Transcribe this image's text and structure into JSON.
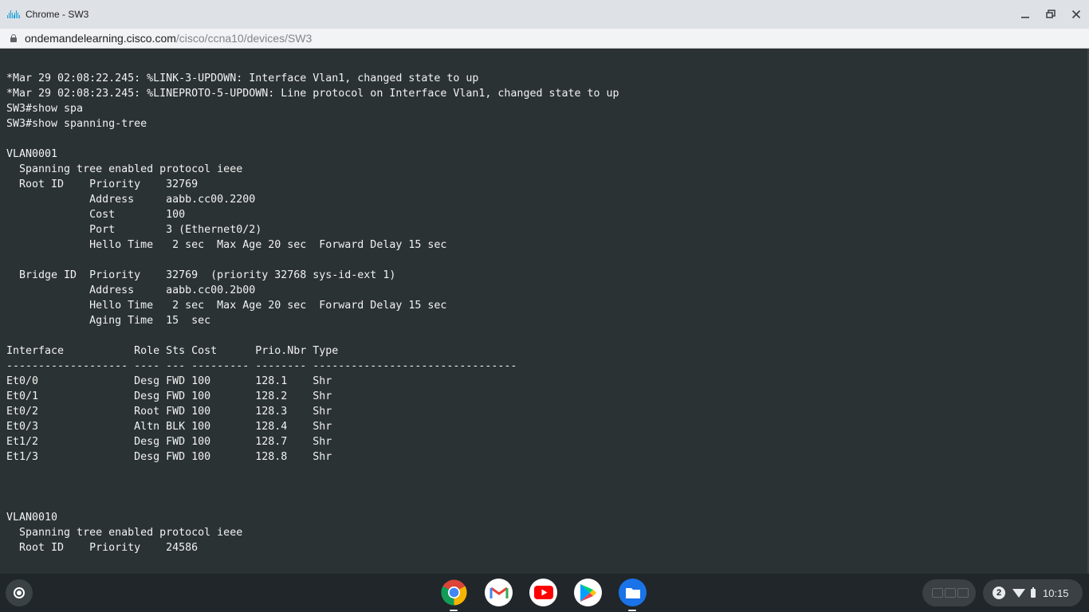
{
  "window": {
    "title": "Chrome - SW3",
    "minimize_icon": "minimize-icon",
    "restore_icon": "restore-icon",
    "close_icon": "close-icon"
  },
  "address_bar": {
    "host": "ondemandelearning.cisco.com",
    "path": "/cisco/ccna10/devices/SW3"
  },
  "terminal": {
    "lines": [
      "*Mar 29 02:08:22.245: %LINK-3-UPDOWN: Interface Vlan1, changed state to up",
      "*Mar 29 02:08:23.245: %LINEPROTO-5-UPDOWN: Line protocol on Interface Vlan1, changed state to up",
      "SW3#show spa",
      "SW3#show spanning-tree",
      "",
      "VLAN0001",
      "  Spanning tree enabled protocol ieee",
      "  Root ID    Priority    32769",
      "             Address     aabb.cc00.2200",
      "             Cost        100",
      "             Port        3 (Ethernet0/2)",
      "             Hello Time   2 sec  Max Age 20 sec  Forward Delay 15 sec",
      "",
      "  Bridge ID  Priority    32769  (priority 32768 sys-id-ext 1)",
      "             Address     aabb.cc00.2b00",
      "             Hello Time   2 sec  Max Age 20 sec  Forward Delay 15 sec",
      "             Aging Time  15  sec",
      "",
      "Interface           Role Sts Cost      Prio.Nbr Type",
      "------------------- ---- --- --------- -------- --------------------------------",
      "Et0/0               Desg FWD 100       128.1    Shr",
      "Et0/1               Desg FWD 100       128.2    Shr",
      "Et0/2               Root FWD 100       128.3    Shr",
      "Et0/3               Altn BLK 100       128.4    Shr",
      "Et1/2               Desg FWD 100       128.7    Shr",
      "Et1/3               Desg FWD 100       128.8    Shr",
      "",
      "",
      "",
      "VLAN0010",
      "  Spanning tree enabled protocol ieee",
      "  Root ID    Priority    24586"
    ]
  },
  "shelf": {
    "launcher_icon": "launcher-icon",
    "apps": [
      {
        "name": "chrome-icon",
        "active": true
      },
      {
        "name": "gmail-icon",
        "active": false
      },
      {
        "name": "youtube-icon",
        "active": false
      },
      {
        "name": "play-store-icon",
        "active": false
      },
      {
        "name": "files-icon",
        "active": true
      }
    ],
    "notification_count": "2",
    "time": "10:15"
  }
}
